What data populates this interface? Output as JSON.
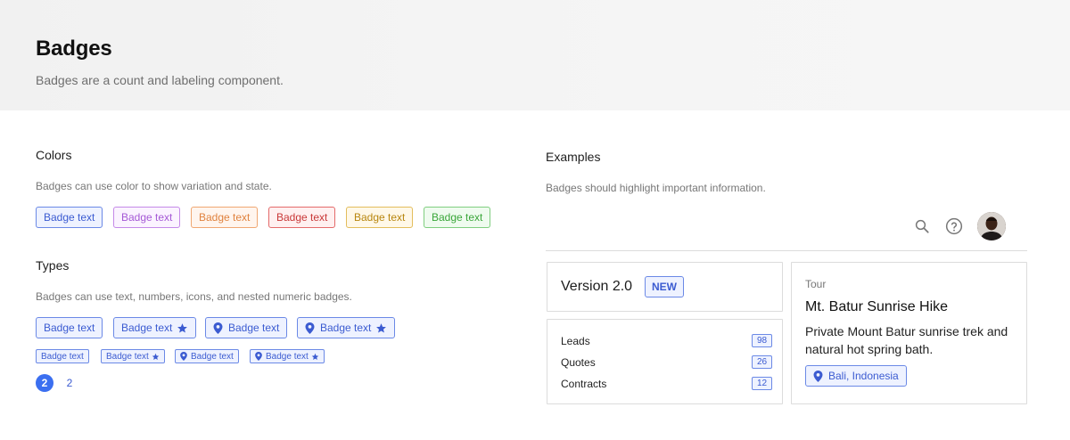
{
  "header": {
    "title": "Badges",
    "subtitle": "Badges are a count and labeling component."
  },
  "colors_section": {
    "title": "Colors",
    "description": "Badges can use color to show variation and state.",
    "badges": [
      {
        "label": "Badge text",
        "color": "#3b5bd1"
      },
      {
        "label": "Badge text",
        "color": "#a559d6"
      },
      {
        "label": "Badge text",
        "color": "#e0823e"
      },
      {
        "label": "Badge text",
        "color": "#c93838"
      },
      {
        "label": "Badge text",
        "color": "#b8860f"
      },
      {
        "label": "Badge text",
        "color": "#3aa63a"
      }
    ]
  },
  "types_section": {
    "title": "Types",
    "description": "Badges can use text, numbers, icons, and nested numeric badges.",
    "large_badges": [
      {
        "label": "Badge text",
        "icon": ""
      },
      {
        "label": "Badge text",
        "icon": "star-icon"
      },
      {
        "label": "Badge text",
        "icon": "location-pin-icon"
      },
      {
        "label": "Badge text",
        "icon": "location-pin-icon + star-icon"
      }
    ],
    "small_badges": [
      {
        "label": "Badge text",
        "icon": ""
      },
      {
        "label": "Badge text",
        "icon": "star-icon"
      },
      {
        "label": "Badge text",
        "icon": "location-pin-icon"
      },
      {
        "label": "Badge text",
        "icon": "location-pin-icon + star-icon"
      }
    ],
    "numeric_badges": [
      {
        "value": "2",
        "style": "filled"
      },
      {
        "value": "2",
        "style": "plain"
      }
    ]
  },
  "examples_section": {
    "title": "Examples",
    "description": "Badges should highlight important information.",
    "toolbar": {
      "search_icon": "search-icon",
      "help_icon": "help-circle-icon",
      "avatar": "user-avatar"
    },
    "version_card": {
      "title": "Version 2.0",
      "badge": "NEW"
    },
    "stats_card": {
      "rows": [
        {
          "label": "Leads",
          "count": "98"
        },
        {
          "label": "Quotes",
          "count": "26"
        },
        {
          "label": "Contracts",
          "count": "12"
        }
      ]
    },
    "tour_card": {
      "category": "Tour",
      "title": "Mt. Batur Sunrise Hike",
      "description": "Private Mount Batur sunrise trek and natural hot spring bath.",
      "location": "Bali, Indonesia"
    }
  },
  "accent_color": "#3b6ff0"
}
